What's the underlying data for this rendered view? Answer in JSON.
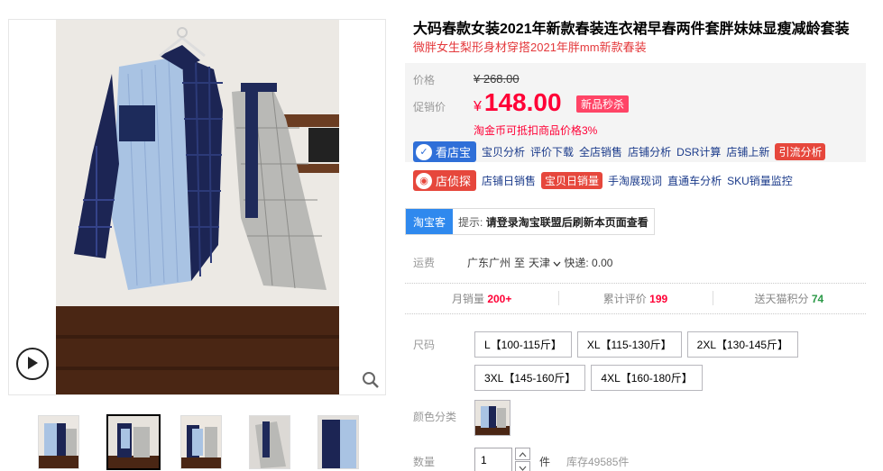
{
  "product": {
    "title": "大码春款女装2021年新款春装连衣裙早春两件套胖妹妹显瘦减龄套装",
    "subtitle": "微胖女生梨形身材穿搭2021年胖mm新款春装"
  },
  "price": {
    "orig_label": "价格",
    "orig_value": "¥ 268.00",
    "promo_label": "促销价",
    "currency": "¥",
    "promo_value": "148.00",
    "promo_tag": "新品秒杀",
    "coin_note": "淘金币可抵扣商品价格3%"
  },
  "tools_row1": {
    "brand": "看店宝",
    "links": [
      "宝贝分析",
      "评价下载",
      "全店销售",
      "店铺分析",
      "DSR计算",
      "店铺上新"
    ],
    "highlight": "引流分析"
  },
  "tools_row2": {
    "brand": "店侦探",
    "link_a": "店铺日销售",
    "highlight": "宝贝日销量",
    "links": [
      "手淘展现词",
      "直通车分析",
      "SKU销量监控"
    ]
  },
  "taobaoke": {
    "tag": "淘宝客",
    "hint_prefix": "提示:",
    "hint_text": "请登录淘宝联盟后刷新本页面查看"
  },
  "shipping": {
    "label": "运费",
    "from": "广东广州",
    "to_word": "至",
    "to": "天津",
    "express": "快递: 0.00"
  },
  "stats": {
    "monthly_label": "月销量",
    "monthly_value": "200+",
    "reviews_label": "累计评价",
    "reviews_value": "199",
    "points_label": "送天猫积分",
    "points_value": "74"
  },
  "sku": {
    "size_label": "尺码",
    "sizes": [
      "L【100-115斤】",
      "XL【115-130斤】",
      "2XL【130-145斤】",
      "3XL【145-160斤】",
      "4XL【160-180斤】"
    ],
    "color_label": "颜色分类",
    "qty_label": "数量",
    "qty_value": "1",
    "qty_unit": "件",
    "stock": "库存49585件"
  },
  "colors": {
    "price_red": "#ff0036",
    "brand_blue": "#2f6fd8",
    "brand_red": "#e6473c",
    "tbk_blue": "#2f89ee",
    "points_green": "#2b9947"
  }
}
